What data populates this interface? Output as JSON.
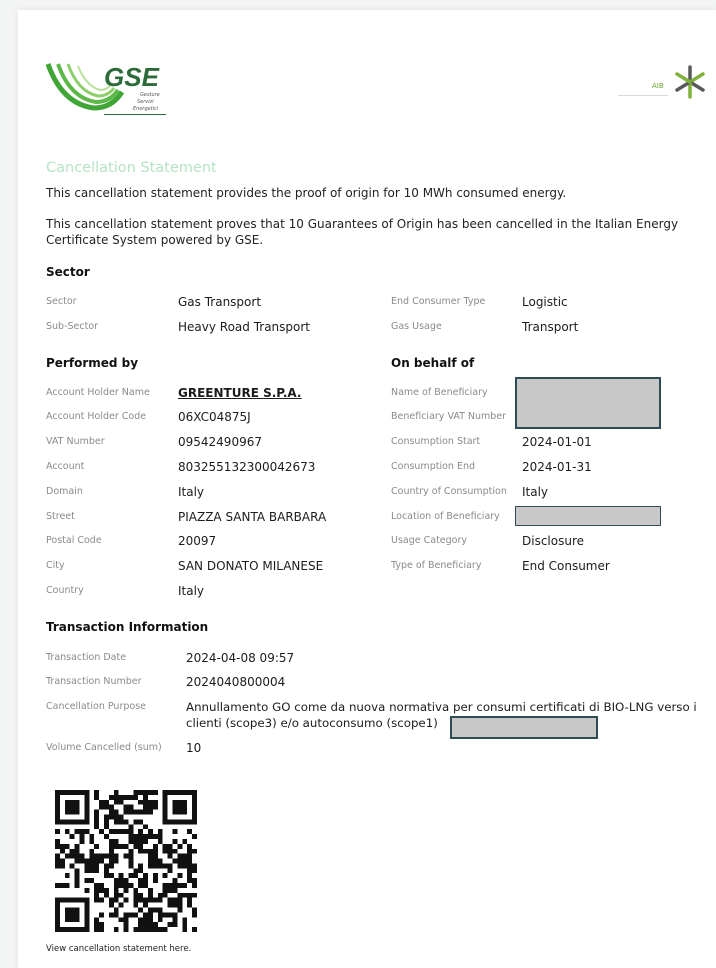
{
  "header": {
    "gse_logo_text": "GSE",
    "gse_logo_sub": [
      "Gestore",
      "Servizi",
      "Energetici"
    ],
    "aib_logo_text": "AIB"
  },
  "statement": {
    "title": "Cancellation Statement",
    "intro1": "This cancellation statement provides the proof of origin for 10 MWh consumed energy.",
    "intro2_line1": "This cancellation statement proves that 10 Guarantees of Origin has been cancelled in the Italian Energy",
    "intro2_line2": "Certificate System powered by GSE."
  },
  "sector": {
    "heading": "Sector",
    "rows": [
      {
        "label": "Sector",
        "value": "Gas Transport",
        "label2": "End Consumer Type",
        "value2": "Logistic"
      },
      {
        "label": "Sub-Sector",
        "value": "Heavy Road Transport",
        "label2": "Gas Usage",
        "value2": "Transport"
      }
    ]
  },
  "performed_by": {
    "heading": "Performed by",
    "rows": [
      {
        "label": "Account Holder Name",
        "value": "GREENTURE S.P.A."
      },
      {
        "label": "Account Holder Code",
        "value": "06XC04875J"
      },
      {
        "label": "VAT Number",
        "value": "09542490967"
      },
      {
        "label": "Account",
        "value": "803255132300042673"
      },
      {
        "label": "Domain",
        "value": "Italy"
      },
      {
        "label": "Street",
        "value": "PIAZZA SANTA BARBARA"
      },
      {
        "label": "Postal Code",
        "value": "20097"
      },
      {
        "label": "City",
        "value": "SAN DONATO MILANESE"
      },
      {
        "label": "Country",
        "value": "Italy"
      }
    ]
  },
  "on_behalf_of": {
    "heading": "On behalf of",
    "rows": [
      {
        "label": "Name of Beneficiary",
        "value": ""
      },
      {
        "label": "Beneficiary VAT Number",
        "value": ""
      },
      {
        "label": "Consumption Start",
        "value": "2024-01-01"
      },
      {
        "label": "Consumption End",
        "value": "2024-01-31"
      },
      {
        "label": "Country of Consumption",
        "value": "Italy"
      },
      {
        "label": "Location of Beneficiary",
        "value": ""
      },
      {
        "label": "Usage Category",
        "value": "Disclosure"
      },
      {
        "label": "Type of Beneficiary",
        "value": "End Consumer"
      }
    ]
  },
  "transaction": {
    "heading": "Transaction Information",
    "date_label": "Transaction Date",
    "date_value": "2024-04-08 09:57",
    "number_label": "Transaction Number",
    "number_value": "2024040800004",
    "purpose_label": "Cancellation Purpose",
    "purpose_line1": "Annullamento GO come da nuova normativa per consumi certificati di BIO-LNG verso i",
    "purpose_line2": "clienti (scope3) e/o autoconsumo (scope1)",
    "volume_label": "Volume Cancelled (sum)",
    "volume_value": "10"
  },
  "footer": {
    "qr_caption": "View cancellation statement here."
  },
  "colors": {
    "gse_green": "#3fa535",
    "title_green": "#b5e3c3",
    "redaction_fill": "#c8c8c8",
    "redaction_border": "#2f4b55"
  }
}
